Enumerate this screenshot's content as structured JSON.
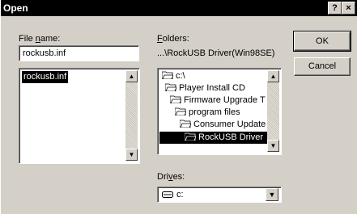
{
  "window": {
    "title": "Open",
    "help_glyph": "?",
    "close_glyph": "×"
  },
  "file_name": {
    "label_pre": "File ",
    "label_u": "n",
    "label_post": "ame:",
    "value": "rockusb.inf",
    "list": [
      "rockusb.inf"
    ]
  },
  "folders": {
    "label_u": "F",
    "label_post": "olders:",
    "current_path": "...\\RockUSB Driver(Win98SE)",
    "tree": [
      "c:\\",
      "Player Install CD",
      "Firmware Upgrade T",
      "program files",
      "Consumer Update",
      "RockUSB Driver"
    ],
    "selected_index": 5
  },
  "buttons": {
    "ok": "OK",
    "cancel": "Cancel"
  },
  "drives": {
    "label_pre": "Dri",
    "label_u": "v",
    "label_post": "es:",
    "value": "c:"
  }
}
